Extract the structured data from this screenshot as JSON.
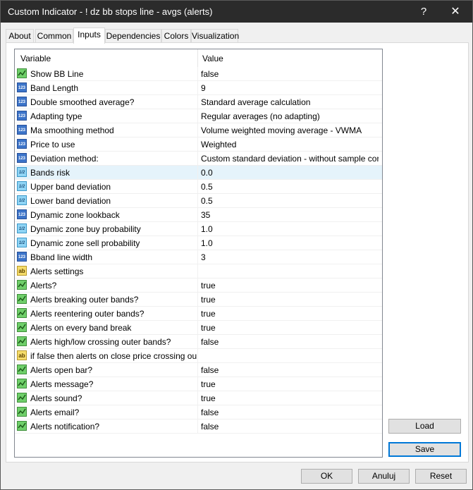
{
  "window": {
    "title": "Custom Indicator - ! dz bb stops line - avgs (alerts)",
    "help_glyph": "?",
    "close_glyph": "✕"
  },
  "tabs": [
    {
      "label": "About"
    },
    {
      "label": "Common"
    },
    {
      "label": "Inputs"
    },
    {
      "label": "Dependencies"
    },
    {
      "label": "Colors"
    },
    {
      "label": "Visualization"
    }
  ],
  "active_tab": "Inputs",
  "grid": {
    "columns": {
      "variable": "Variable",
      "value": "Value"
    },
    "rows": [
      {
        "icon": "bool-icon",
        "type": "bool",
        "label": "Show BB Line",
        "value": "false"
      },
      {
        "icon": "int-icon",
        "type": "int",
        "label": "Band Length",
        "value": "9"
      },
      {
        "icon": "int-icon",
        "type": "int",
        "label": "Double smoothed average?",
        "value": "Standard average calculation"
      },
      {
        "icon": "int-icon",
        "type": "int",
        "label": "Adapting type",
        "value": "Regular averages (no adapting)"
      },
      {
        "icon": "int-icon",
        "type": "int",
        "label": "Ma smoothing method",
        "value": "Volume weighted moving average - VWMA"
      },
      {
        "icon": "int-icon",
        "type": "int",
        "label": "Price to use",
        "value": "Weighted"
      },
      {
        "icon": "int-icon",
        "type": "int",
        "label": "Deviation method:",
        "value": "Custom standard deviation - without sample correct..."
      },
      {
        "icon": "double-icon",
        "type": "double",
        "label": "Bands risk",
        "value": "0.0",
        "selected": true
      },
      {
        "icon": "double-icon",
        "type": "double",
        "label": "Upper band deviation",
        "value": "0.5"
      },
      {
        "icon": "double-icon",
        "type": "double",
        "label": "Lower band deviation",
        "value": "0.5"
      },
      {
        "icon": "int-icon",
        "type": "int",
        "label": "Dynamic zone lookback",
        "value": "35"
      },
      {
        "icon": "double-icon",
        "type": "double",
        "label": "Dynamic zone buy probability",
        "value": "1.0"
      },
      {
        "icon": "double-icon",
        "type": "double",
        "label": "Dynamic zone sell probability",
        "value": "1.0"
      },
      {
        "icon": "int-icon",
        "type": "int",
        "label": "Bband line width",
        "value": "3"
      },
      {
        "icon": "string-icon",
        "type": "string",
        "label": "Alerts settings",
        "value": ""
      },
      {
        "icon": "bool-icon",
        "type": "bool",
        "label": "Alerts?",
        "value": "true"
      },
      {
        "icon": "bool-icon",
        "type": "bool",
        "label": "Alerts breaking outer bands?",
        "value": "true"
      },
      {
        "icon": "bool-icon",
        "type": "bool",
        "label": "Alerts reentering outer bands?",
        "value": "true"
      },
      {
        "icon": "bool-icon",
        "type": "bool",
        "label": "Alerts on every band break",
        "value": "true"
      },
      {
        "icon": "bool-icon",
        "type": "bool",
        "label": "Alerts high/low crossing outer bands?",
        "value": "false"
      },
      {
        "icon": "string-icon",
        "type": "string",
        "label": "if false then alerts on close price crossing outer ...",
        "value": ""
      },
      {
        "icon": "bool-icon",
        "type": "bool",
        "label": "Alerts open bar?",
        "value": "false"
      },
      {
        "icon": "bool-icon",
        "type": "bool",
        "label": "Alerts message?",
        "value": "true"
      },
      {
        "icon": "bool-icon",
        "type": "bool",
        "label": "Alerts sound?",
        "value": "true"
      },
      {
        "icon": "bool-icon",
        "type": "bool",
        "label": "Alerts email?",
        "value": "false"
      },
      {
        "icon": "bool-icon",
        "type": "bool",
        "label": "Alerts notification?",
        "value": "false"
      }
    ]
  },
  "side_buttons": {
    "load": "Load",
    "save": "Save"
  },
  "footer_buttons": {
    "ok": "OK",
    "cancel": "Anuluj",
    "reset": "Reset"
  },
  "icon_glyphs": {
    "int": "123",
    "double": "1/2",
    "string": "ab"
  },
  "colors": {
    "titlebar": "#2b2b2b",
    "selected_row": "#e5f3fb",
    "focus_border": "#0078d7"
  }
}
